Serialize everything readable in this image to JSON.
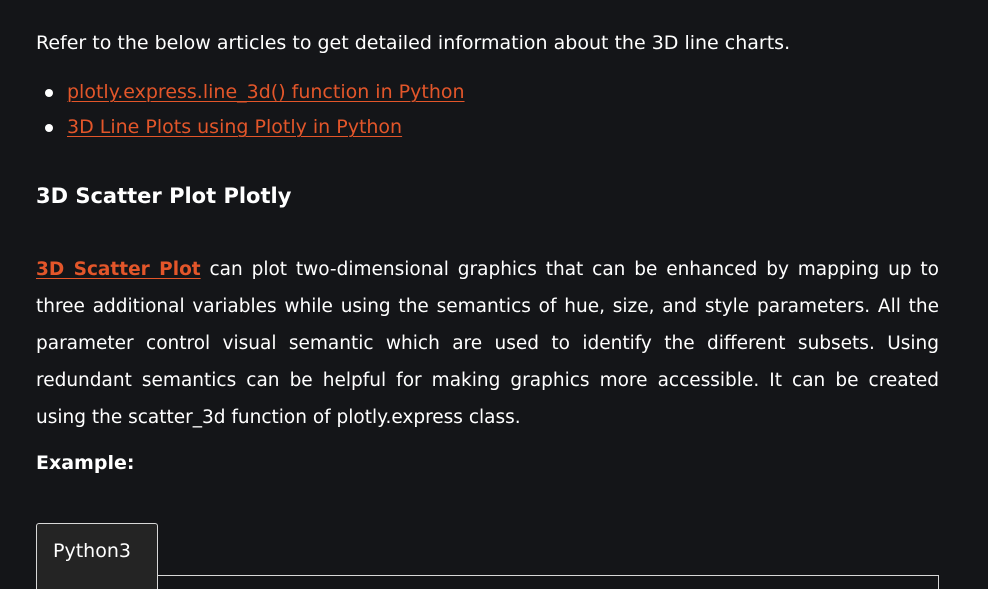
{
  "intro": "Refer to the below articles to get detailed information about the 3D line charts.",
  "articles": [
    "plotly.express.line_3d() function in Python",
    "3D Line Plots using Plotly in Python"
  ],
  "section_heading": "3D Scatter Plot Plotly",
  "paragraph": {
    "link_text": "3D Scatter Plot",
    "text": " can plot two-dimensional graphics that can be enhanced by mapping up to three additional variables while using the semantics of hue, size, and style parameters. All the parameter control visual semantic which are used to identify the different subsets. Using redundant semantics can be helpful for making graphics more accessible. It can be created using the scatter_3d function of plotly.express class."
  },
  "example_label": "Example:",
  "code_tab_label": "Python3",
  "colors": {
    "background": "#141518",
    "link": "#e3562a",
    "text": "#ffffff"
  }
}
